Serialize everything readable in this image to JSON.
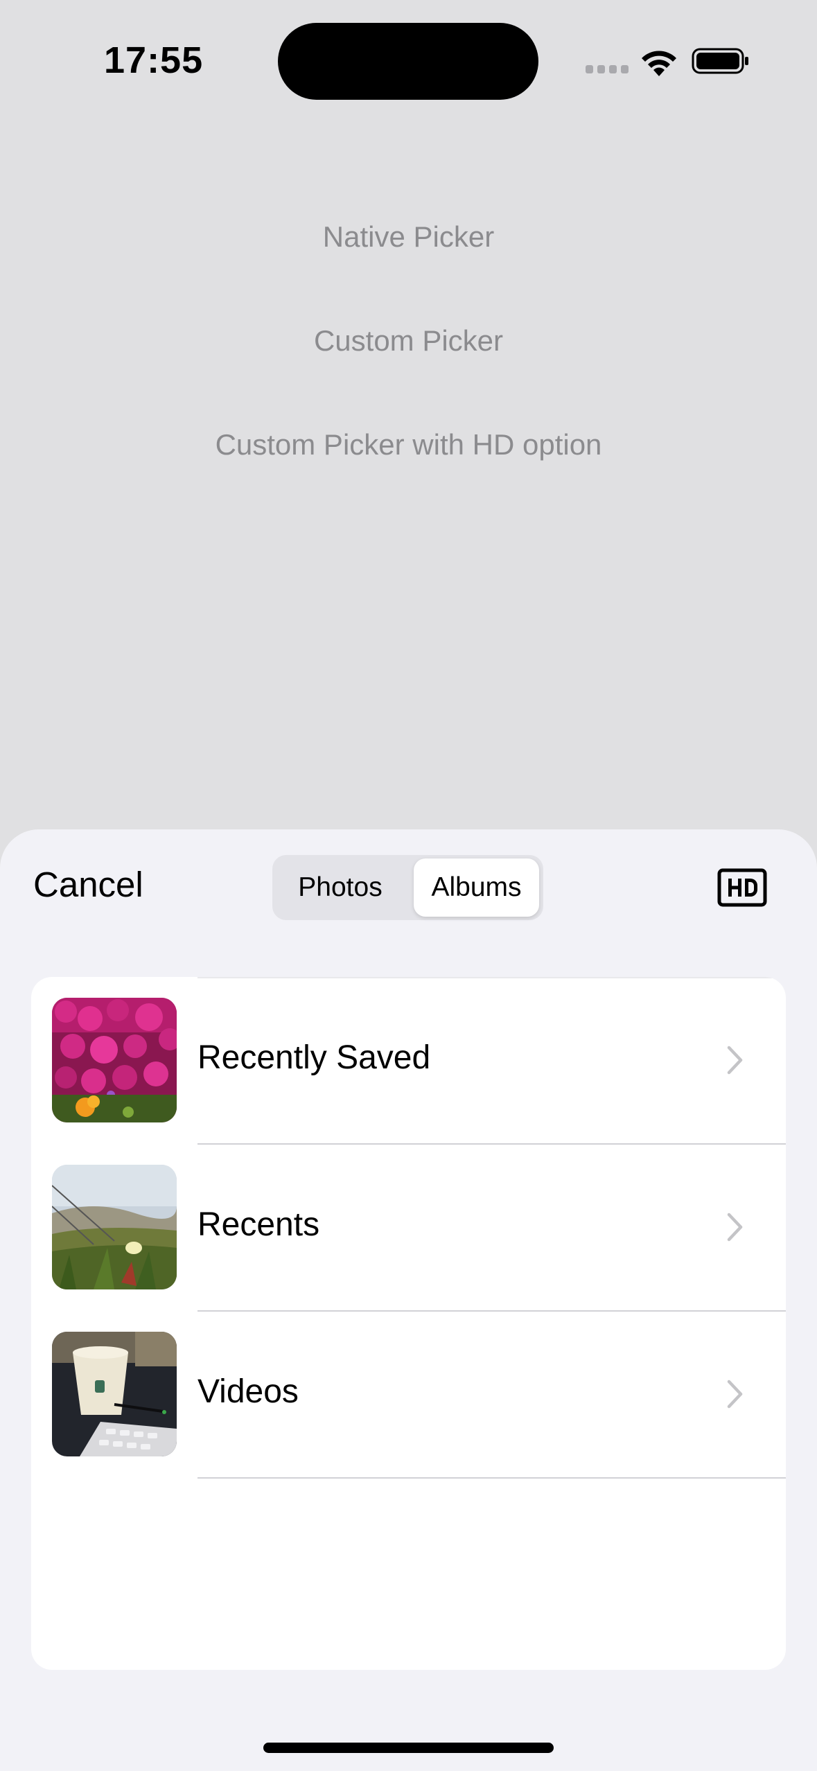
{
  "status_bar": {
    "time": "17:55",
    "icons": [
      "signal-dots-icon",
      "wifi-icon",
      "battery-icon"
    ]
  },
  "menu": {
    "options": [
      {
        "label": "Native Picker"
      },
      {
        "label": "Custom Picker"
      },
      {
        "label": "Custom Picker with HD option"
      }
    ]
  },
  "sheet": {
    "cancel_label": "Cancel",
    "segments": [
      {
        "label": "Photos",
        "selected": false
      },
      {
        "label": "Albums",
        "selected": true
      }
    ],
    "hd_icon": "hd-icon",
    "albums": [
      {
        "title": "Recently Saved",
        "thumbnail": "pink-flowers-thumbnail"
      },
      {
        "title": "Recents",
        "thumbnail": "beach-plants-thumbnail"
      },
      {
        "title": "Videos",
        "thumbnail": "coffee-cup-keyboard-thumbnail"
      }
    ]
  },
  "colors": {
    "background": "#e0e0e2",
    "sheet": "#f2f2f7",
    "menu_text": "#8b8b8e",
    "separator": "#d1d1d6",
    "chevron": "#c4c4c7"
  }
}
